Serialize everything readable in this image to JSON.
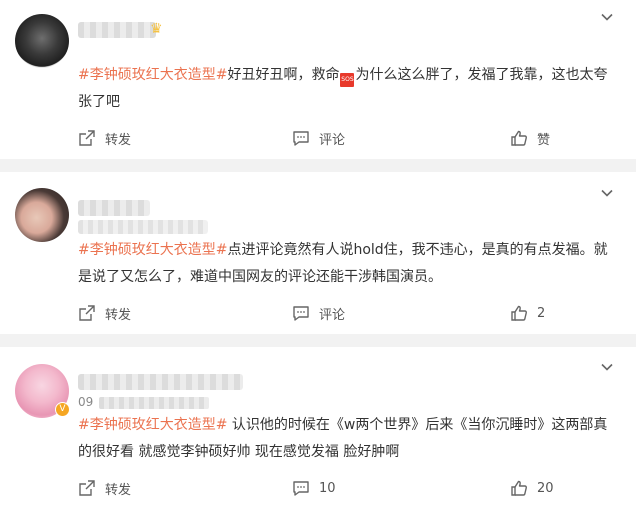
{
  "posts": [
    {
      "content": {
        "topic": "#李钟硕玫红大衣造型#",
        "text_before_emoji": "好丑好丑啊，救命",
        "emoji_text": "SOS",
        "text_after_emoji": "为什么这么胖了，发福了我靠，这也太夸张了吧"
      },
      "actions": {
        "repost": "转发",
        "comment": "评论",
        "like": "赞"
      }
    },
    {
      "content": {
        "topic": "#李钟硕玫红大衣造型#",
        "text": "点进评论竟然有人说hold住，我不违心，是真的有点发福。就是说了又怎么了，难道中国网友的评论还能干涉韩国演员。"
      },
      "actions": {
        "repost": "转发",
        "comment": "评论",
        "like": "2"
      }
    },
    {
      "meta_prefix": "09",
      "content": {
        "topic": "#李钟硕玫红大衣造型#",
        "text": " 认识他的时候在《w两个世界》后来《当你沉睡时》这两部真的很好看 就感觉李钟硕好帅 现在感觉发福 脸好肿啊"
      },
      "actions": {
        "repost": "转发",
        "comment": "10",
        "like": "20"
      }
    }
  ],
  "icons": {
    "more": "chevron-down-icon",
    "repost": "repost-icon",
    "comment": "comment-icon",
    "like": "thumbs-up-icon"
  },
  "colors": {
    "topic": "#eb7350",
    "divider": "#f2f2f2",
    "action_text": "#555555"
  }
}
